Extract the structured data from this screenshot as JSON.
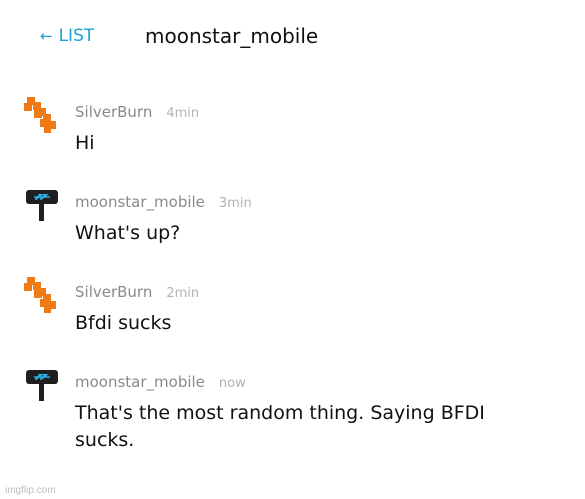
{
  "header": {
    "back_arrow": "←",
    "back_label": "LIST",
    "title": "moonstar_mobile",
    "accent_color": "#1ba3d6"
  },
  "messages": [
    {
      "author": "SilverBurn",
      "time": "4min",
      "text": "Hi",
      "avatar_icon": "orange-pixel-flame-avatar"
    },
    {
      "author": "moonstar_mobile",
      "time": "3min",
      "text": "What's up?",
      "avatar_icon": "hammer-sign-avatar"
    },
    {
      "author": "SilverBurn",
      "time": "2min",
      "text": "Bfdi sucks",
      "avatar_icon": "orange-pixel-flame-avatar"
    },
    {
      "author": "moonstar_mobile",
      "time": "now",
      "text": "That's the most random thing. Saying BFDI sucks.",
      "avatar_icon": "hammer-sign-avatar"
    }
  ],
  "watermark": "imgflip.com"
}
